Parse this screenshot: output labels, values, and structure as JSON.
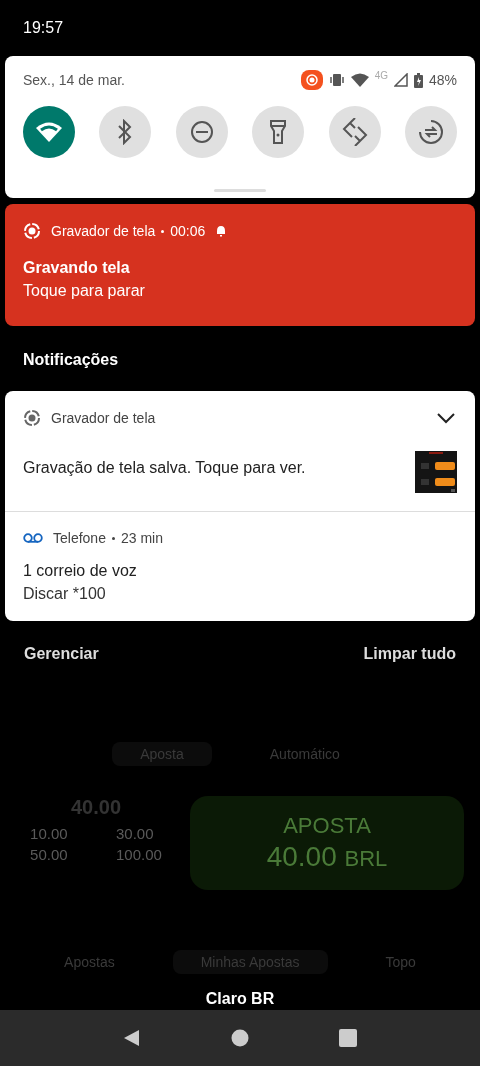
{
  "status_bar": {
    "time": "19:57"
  },
  "quick_settings": {
    "date": "Sex., 14 de mar.",
    "network": "4G",
    "battery": "48%",
    "tiles": [
      {
        "kind": "wifi",
        "on": true
      },
      {
        "kind": "bluetooth",
        "on": false
      },
      {
        "kind": "dnd",
        "on": false
      },
      {
        "kind": "flashlight",
        "on": false
      },
      {
        "kind": "rotate",
        "on": false
      },
      {
        "kind": "data_saver",
        "on": false
      }
    ]
  },
  "recording": {
    "app": "Gravador de tela",
    "elapsed": "00:06",
    "title": "Gravando tela",
    "text": "Toque para parar"
  },
  "section_title": "Notificações",
  "notifications": [
    {
      "kind": "recorder",
      "app": "Gravador de tela",
      "text": "Gravação de tela salva. Toque para ver.",
      "expandable": true
    },
    {
      "kind": "voicemail",
      "app": "Telefone",
      "time": "23 min",
      "title": "1 correio de voz",
      "text": "Discar *100"
    }
  ],
  "actions": [
    "Gerenciar",
    "Limpar tudo"
  ],
  "background_app": {
    "tabs": [
      {
        "label": "Aposta",
        "selected": true
      },
      {
        "label": "Automático",
        "selected": false
      }
    ],
    "amount": "40.00",
    "chips": [
      "10.00",
      "30.00",
      "50.00",
      "100.00"
    ],
    "bet_label": "APOSTA",
    "bet_value": "40.00",
    "bet_currency": "BRL",
    "bottom_tabs": [
      {
        "label": "Apostas",
        "selected": false
      },
      {
        "label": "Minhas Apostas",
        "selected": true
      },
      {
        "label": "Topo",
        "selected": false
      }
    ]
  },
  "carrier": "Claro BR"
}
